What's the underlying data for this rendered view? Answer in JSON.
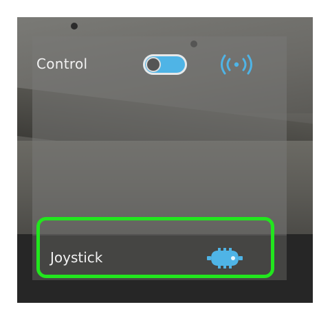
{
  "control": {
    "label": "Control",
    "toggle_state": "on",
    "icons": {
      "toggle": "toggle-switch",
      "signal": "broadcast-signal-icon"
    }
  },
  "joystick": {
    "label": "Joystick",
    "icon": "gamepad-icon"
  },
  "colors": {
    "accent": "#4fb4e6",
    "highlight": "#22e61e",
    "label_text": "#f2f2f2"
  }
}
